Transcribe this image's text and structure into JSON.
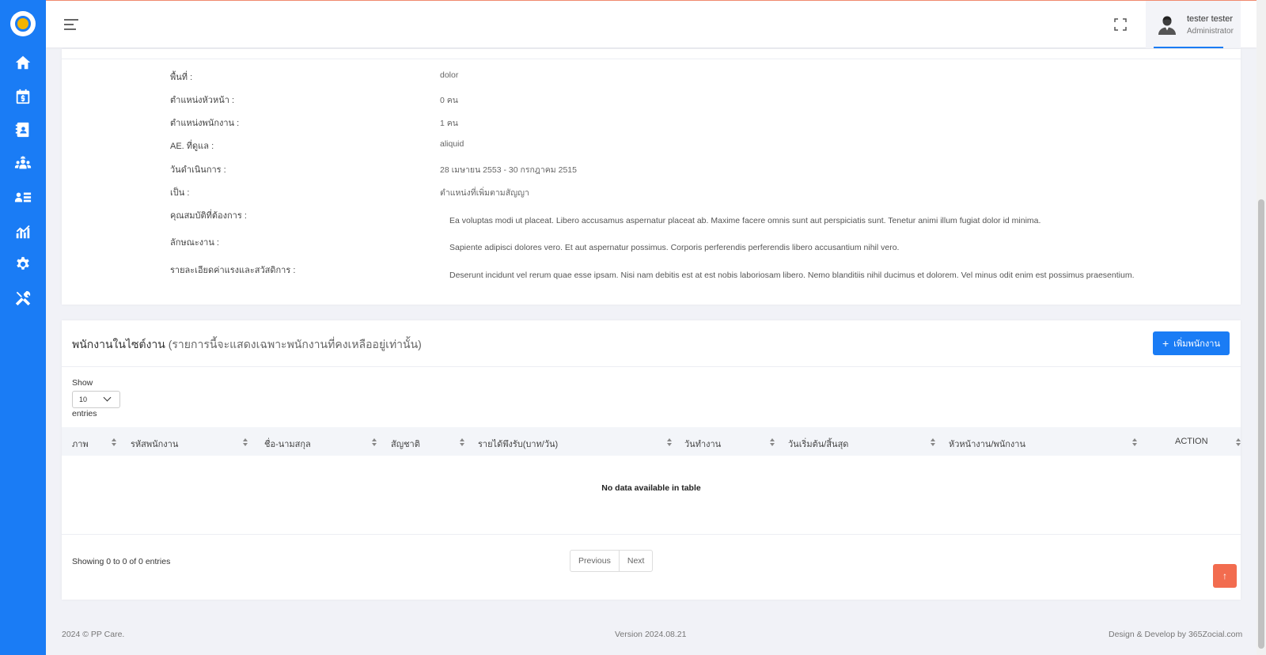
{
  "topbar": {
    "user_name": "tester tester",
    "user_role": "Administrator"
  },
  "details": {
    "area_label": "พื้นที่ :",
    "area_value": "dolor",
    "head_position_label": "ตำแหน่งหัวหน้า :",
    "head_position_value": "0 คน",
    "staff_position_label": "ตำแหน่งพนักงาน :",
    "staff_position_value": "1 คน",
    "ae_label": "AE. ที่ดูแล :",
    "ae_value": "aliquid",
    "operation_date_label": "วันดำเนินการ :",
    "operation_date_value": "28 เมษายน 2553 - 30 กรกฎาคม 2515",
    "type_label": "เป็น :",
    "type_value": "ตำแหน่งที่เพิ่มตามสัญญา",
    "qualification_label": "คุณสมบัติที่ต้องการ :",
    "qualification_value": "Ea voluptas modi ut placeat. Libero accusamus aspernatur placeat ab. Maxime facere omnis sunt aut perspiciatis sunt. Tenetur animi illum fugiat dolor id minima.",
    "job_desc_label": "ลักษณะงาน :",
    "job_desc_value": "Sapiente adipisci dolores vero. Et aut aspernatur possimus. Corporis perferendis perferendis libero accusantium nihil vero.",
    "wage_label": "รายละเอียดค่าแรงและสวัสดิการ :",
    "wage_value": "Deserunt incidunt vel rerum quae esse ipsam. Nisi nam debitis est at est nobis laboriosam libero. Nemo blanditiis nihil ducimus et dolorem. Vel minus odit enim est possimus praesentium."
  },
  "staff": {
    "title": "พนักงานในไซต์งาน",
    "subtitle": "(รายการนี้จะแสดงเฉพาะพนักงานที่คงเหลืออยู่เท่านั้น)",
    "add_button": "เพิ่มพนักงาน",
    "show_label": "Show",
    "entries_value": "10",
    "entries_label": "entries",
    "columns": [
      "ภาพ",
      "รหัสพนักงาน",
      "ชื่อ-นามสกุล",
      "สัญชาติ",
      "รายได้พึงรับ(บาท/วัน)",
      "วันทำงาน",
      "วันเริ่มต้น/สิ้นสุด",
      "หัวหน้างาน/พนักงาน",
      "ACTION"
    ],
    "no_data": "No data available in table",
    "showing": "Showing 0 to 0 of 0 entries",
    "prev": "Previous",
    "next": "Next"
  },
  "footer": {
    "copyright": "2024 © PP Care.",
    "version": "Version 2024.08.21",
    "credit": "Design & Develop by 365Zocial.com"
  },
  "icons": {
    "sidebar": [
      "home-icon",
      "calendar-dollar-icon",
      "contact-book-icon",
      "users-gear-icon",
      "user-list-icon",
      "chart-icon",
      "gear-icon",
      "tools-icon"
    ]
  },
  "colors": {
    "sidebar": "#1a7cf5",
    "primary_button": "#1a7cf5",
    "scroll_top": "#f26c4f"
  }
}
